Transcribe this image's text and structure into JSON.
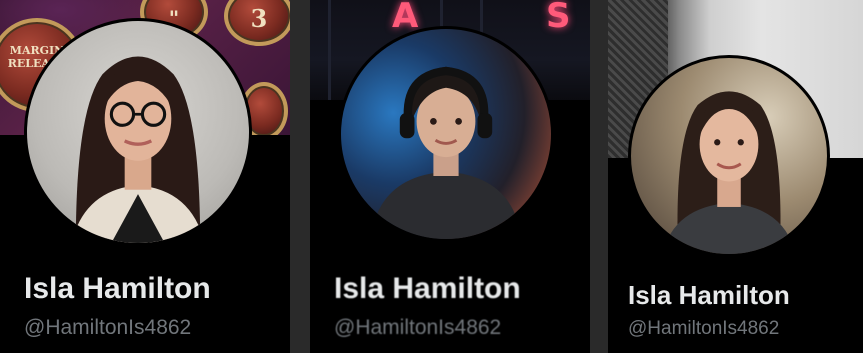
{
  "cards": [
    {
      "name": "Isla Hamilton",
      "handle": "@HamiltonIs4862",
      "banner_keys": [
        "MARGIN RELEASE",
        "\"",
        "3",
        ""
      ]
    },
    {
      "name": "Isla Hamilton",
      "handle": "@HamiltonIs4862",
      "banner_letters": [
        "A",
        "S"
      ]
    },
    {
      "name": "Isla Hamilton",
      "handle": "@HamiltonIs4862"
    }
  ],
  "colors": {
    "background": "#000000",
    "name_text": "#e7e9ea",
    "handle_text": "#71767b"
  }
}
